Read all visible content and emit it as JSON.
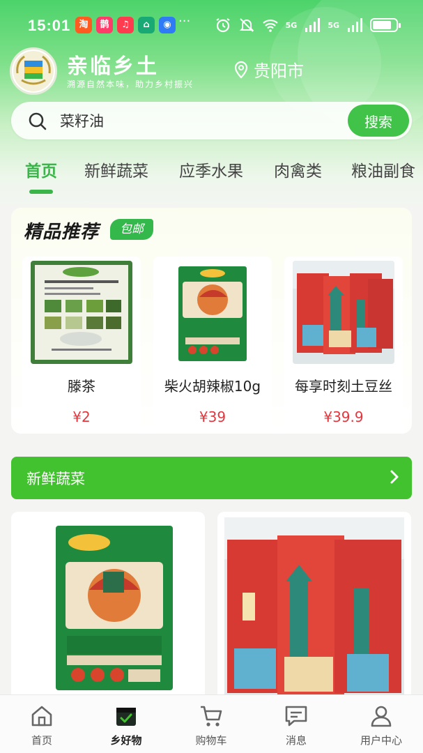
{
  "status_bar": {
    "time": "15:01",
    "app_icons": [
      {
        "label": "淘",
        "color": "#ff5a1f"
      },
      {
        "label": "鹊",
        "color": "#ff3b6a"
      },
      {
        "label": "♫",
        "color": "#ff3b4f"
      },
      {
        "label": "⌂",
        "color": "#19a974"
      },
      {
        "label": "◉",
        "color": "#2f7bf5"
      }
    ],
    "more": "···",
    "network_labels": [
      "5G",
      "5G"
    ],
    "battery_level": 0.8
  },
  "header": {
    "brand_name": "亲临乡土",
    "slogan": "溯源自然本味，助力乡村振兴",
    "location": "贵阳市"
  },
  "search": {
    "value": "菜籽油",
    "button_label": "搜索"
  },
  "tabs": [
    "首页",
    "新鲜蔬菜",
    "应季水果",
    "肉禽类",
    "粮油副食"
  ],
  "featured": {
    "title": "精品推荐",
    "badge": "包邮",
    "products": [
      {
        "name": "滕茶",
        "price": "¥2",
        "image": "tea-poster"
      },
      {
        "name": "柴火胡辣椒10g",
        "price": "¥39",
        "image": "chili-package"
      },
      {
        "name": "每享时刻土豆丝",
        "price": "¥39.9",
        "image": "potato-chips-bags"
      }
    ]
  },
  "section": {
    "title": "新鲜蔬菜"
  },
  "grid_products": [
    {
      "image": "chili-package-large"
    },
    {
      "image": "potato-chips-bags-large"
    }
  ],
  "bottom_nav": [
    {
      "label": "首页",
      "icon": "home-icon",
      "active": false
    },
    {
      "label": "乡好物",
      "icon": "goods-box-icon",
      "active": true
    },
    {
      "label": "购物车",
      "icon": "cart-icon",
      "active": false
    },
    {
      "label": "消息",
      "icon": "message-icon",
      "active": false
    },
    {
      "label": "用户中心",
      "icon": "user-icon",
      "active": false
    }
  ],
  "colors": {
    "brand_green": "#3bb54a",
    "section_green": "#41c22e",
    "price_red": "#e0383e"
  }
}
